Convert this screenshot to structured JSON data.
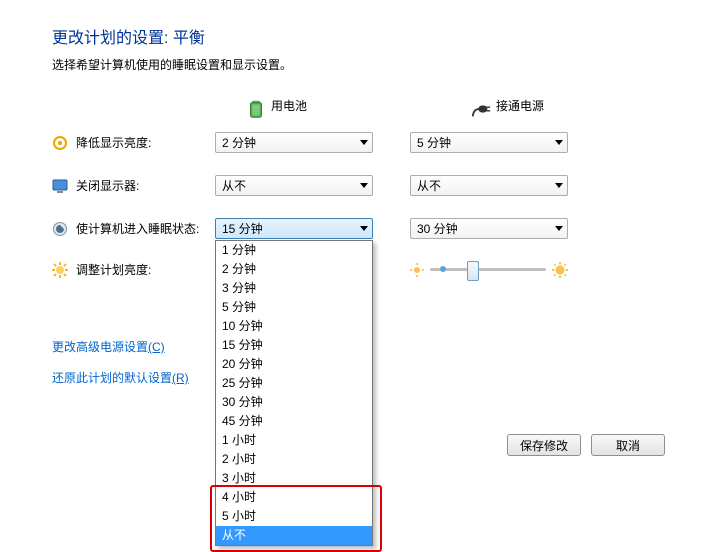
{
  "title": "更改计划的设置: 平衡",
  "subtitle": "选择希望计算机使用的睡眠设置和显示设置。",
  "columns": {
    "battery": "用电池",
    "plugged": "接通电源"
  },
  "rows": {
    "dim": {
      "label": "降低显示亮度:",
      "battery": "2 分钟",
      "plugged": "5 分钟"
    },
    "display": {
      "label": "关闭显示器:",
      "battery": "从不",
      "plugged": "从不"
    },
    "sleep": {
      "label": "使计算机进入睡眠状态:",
      "battery": "15 分钟",
      "plugged": "30 分钟"
    },
    "bright": {
      "label": "调整计划亮度:"
    }
  },
  "dropdown_options": [
    "1 分钟",
    "2 分钟",
    "3 分钟",
    "5 分钟",
    "10 分钟",
    "15 分钟",
    "20 分钟",
    "25 分钟",
    "30 分钟",
    "45 分钟",
    "1 小时",
    "2 小时",
    "3 小时",
    "4 小时",
    "5 小时",
    "从不"
  ],
  "dropdown_selected_index": 15,
  "highlight_start_index": 13,
  "links": {
    "advanced": {
      "text": "更改高级电源设置",
      "accel": "(C)"
    },
    "restore": {
      "text": "还原此计划的默认设置",
      "accel": "(R)"
    }
  },
  "buttons": {
    "save": "保存修改",
    "cancel": "取消"
  }
}
